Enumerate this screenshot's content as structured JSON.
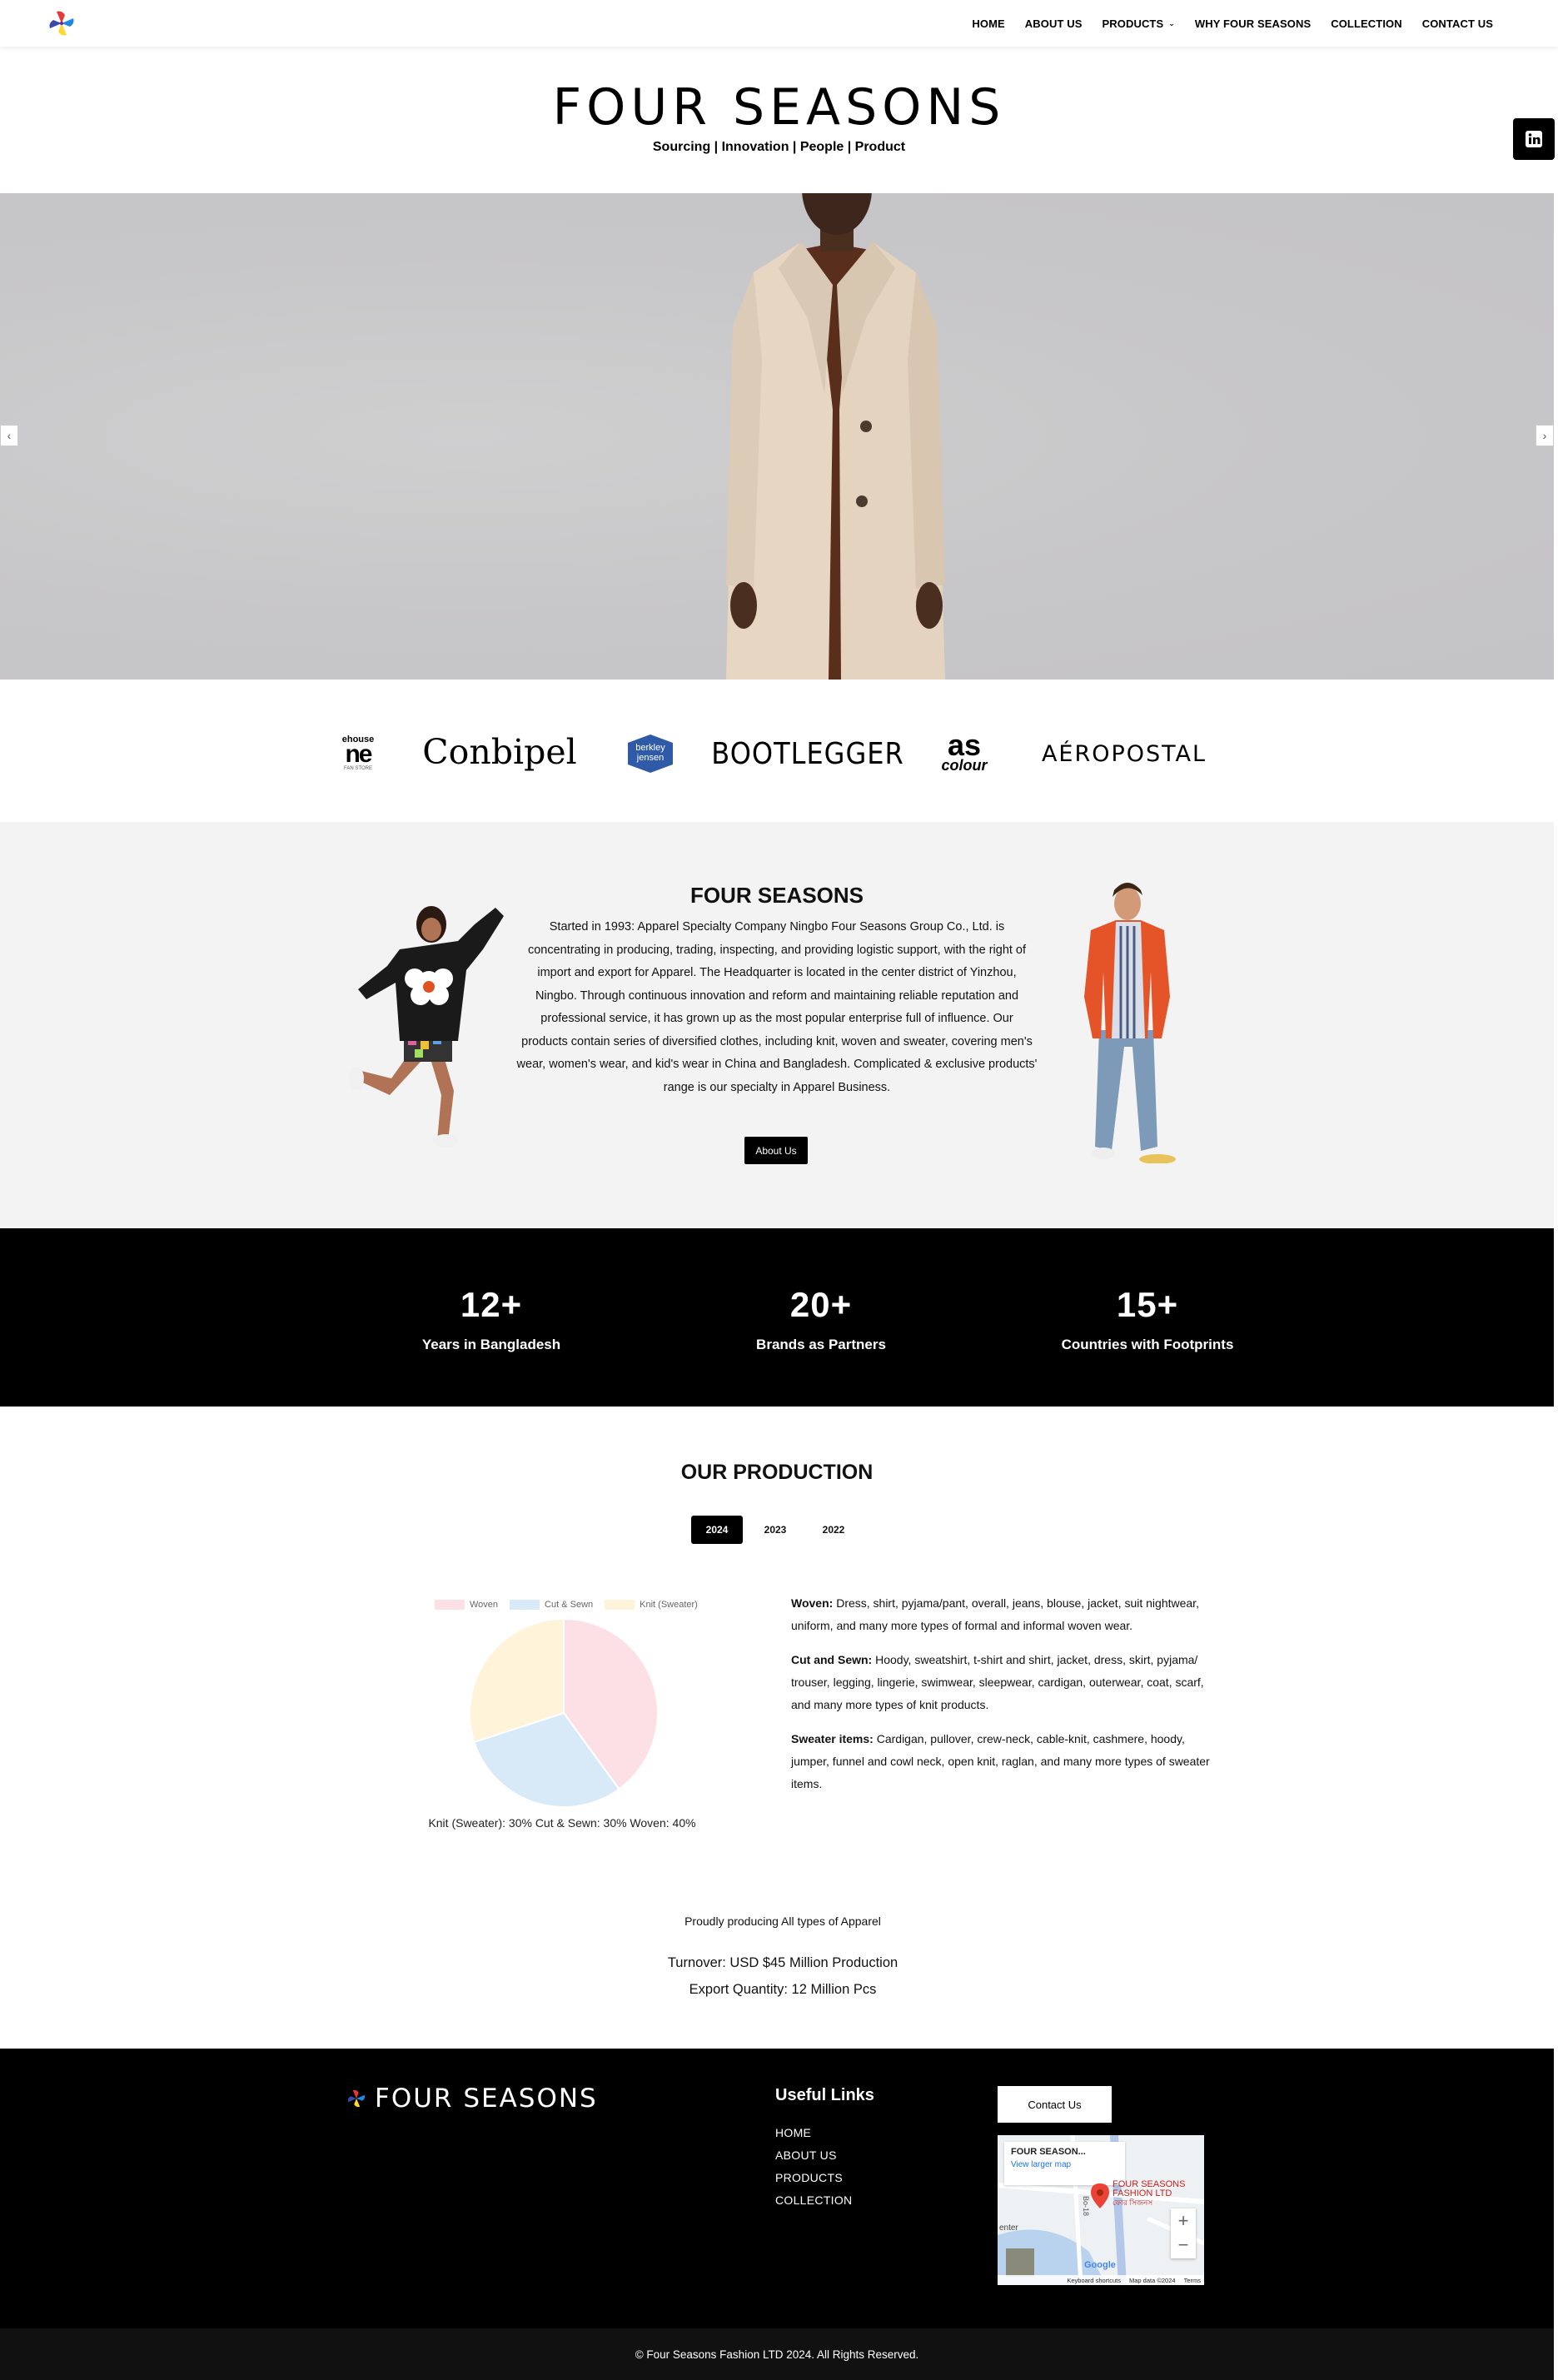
{
  "nav": {
    "items": [
      {
        "label": "HOME"
      },
      {
        "label": "ABOUT US"
      },
      {
        "label": "PRODUCTS"
      },
      {
        "label": "WHY FOUR SEASONS"
      },
      {
        "label": "COLLECTION"
      },
      {
        "label": "CONTACT US"
      }
    ]
  },
  "header": {
    "title": "FOUR SEASONS",
    "tagline": "Sourcing | Innovation | People | Product"
  },
  "hero": {
    "prev": "‹",
    "next": "›"
  },
  "brands": {
    "b1_top": "ehouse",
    "b1_mid": "ne",
    "b1_bot": "FAN STORE",
    "b2": "Conbipel",
    "b3_top": "berkley",
    "b3_bot": "jensen",
    "b4": "BOOTLEGGER",
    "b5_top": "as",
    "b5_bot": "colour",
    "b6": "AÉROPOSTAL"
  },
  "about": {
    "title": "FOUR SEASONS",
    "body": "Started in 1993: Apparel Specialty Company Ningbo Four Seasons Group Co., Ltd. is concentrating in producing, trading, inspecting, and providing logistic support, with the right of import and export for Apparel. The Headquarter is located in the center district of Yinzhou, Ningbo. Through continuous innovation and reform and maintaining reliable reputation and professional service, it has grown up as the most popular enterprise full of influence. Our products contain series of diversified clothes, including knit, woven and sweater, covering men's wear, women's wear, and kid's wear in China and Bangladesh. Complicated & exclusive products' range is our specialty in Apparel Business.",
    "button": "About Us"
  },
  "stats": [
    {
      "value": "12+",
      "label": "Years in Bangladesh"
    },
    {
      "value": "20+",
      "label": "Brands as Partners"
    },
    {
      "value": "15+",
      "label": "Countries with Footprints"
    }
  ],
  "production": {
    "title": "OUR PRODUCTION",
    "tabs": [
      "2024",
      "2023",
      "2022"
    ],
    "active_tab": "2024",
    "caption": "Knit (Sweater): 30% Cut & Sewn: 30% Woven: 40%",
    "woven_label": "Woven:",
    "woven_text": " Dress, shirt, pyjama/pant, overall, jeans, blouse, jacket, suit nightwear, uniform, and many more types of formal and informal woven wear.",
    "cut_label": "Cut and Sewn:",
    "cut_text": " Hoody, sweatshirt, t-shirt and shirt, jacket, dress, skirt, pyjama/ trouser, legging, lingerie, swimwear, sleepwear, cardigan, outerwear, coat, scarf, and many more types of knit products.",
    "sweater_label": "Sweater items:",
    "sweater_text": " Cardigan, pullover, crew-neck, cable-knit, cashmere, hoody, jumper, funnel and cowl neck, open knit, raglan, and many more types of sweater items.",
    "proud": "Proudly producing All types of Apparel",
    "turnover": "Turnover: USD $45 Million Production",
    "export": "Export Quantity: 12 Million Pcs"
  },
  "chart_data": {
    "type": "pie",
    "categories": [
      "Woven",
      "Cut & Sewn",
      "Knit (Sweater)"
    ],
    "values": [
      40,
      30,
      30
    ],
    "colors": [
      "#fde0e6",
      "#d8e9f8",
      "#fff3d9"
    ],
    "legend": "top"
  },
  "footer": {
    "brand": "FOUR SEASONS",
    "links_title": "Useful Links",
    "links": [
      "HOME",
      "ABOUT US",
      "PRODUCTS",
      "COLLECTION"
    ],
    "contact_button": "Contact Us",
    "map": {
      "place": "FOUR SEASON...",
      "larger": "View larger map",
      "pin_label1": "FOUR SEASONS",
      "pin_label2": "FASHION LTD",
      "pin_label3": "ফোর সিজনস",
      "road": "Bo-18",
      "area": "enter",
      "google": "Google",
      "shortcuts": "Keyboard shortcuts",
      "mapdata": "Map data ©2024",
      "terms": "Terms",
      "zoom_in": "+",
      "zoom_out": "−"
    },
    "copyright": "© Four Seasons Fashion LTD 2024. All Rights Reserved."
  }
}
